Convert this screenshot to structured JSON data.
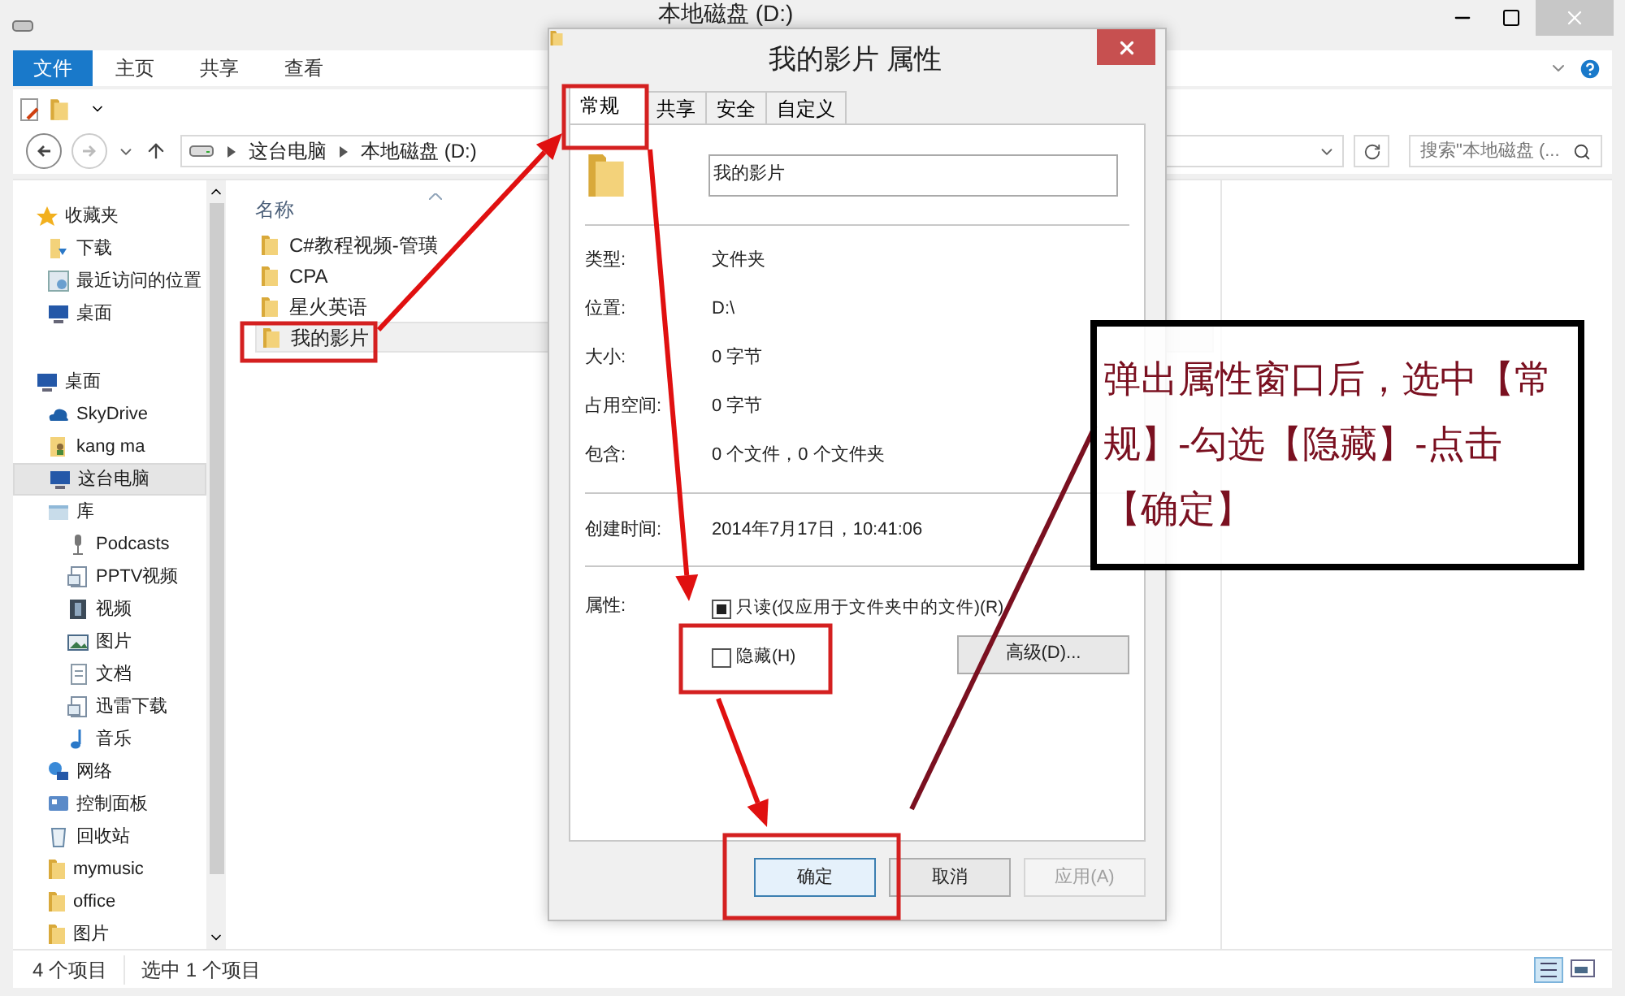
{
  "window": {
    "title": "本地磁盘 (D:)"
  },
  "ribbon_tabs": [
    {
      "label": "文件",
      "kind": "file-menu"
    },
    {
      "label": "主页",
      "kind": "tab"
    },
    {
      "label": "共享",
      "kind": "tab"
    },
    {
      "label": "查看",
      "kind": "tab"
    }
  ],
  "address": {
    "crumbs": [
      "这台电脑",
      "本地磁盘 (D:)"
    ]
  },
  "search": {
    "placeholder": "搜索\"本地磁盘 (..."
  },
  "sidebar": {
    "items": [
      {
        "label": "收藏夹",
        "kind": "star",
        "selected": false,
        "children": [
          {
            "label": "下载",
            "kind": "download",
            "selected": false
          },
          {
            "label": "最近访问的位置",
            "kind": "recent",
            "selected": false
          },
          {
            "label": "桌面",
            "kind": "desktop",
            "selected": false
          }
        ]
      },
      {
        "label": "桌面",
        "kind": "desktop",
        "selected": false,
        "children": [
          {
            "label": "SkyDrive",
            "kind": "cloud",
            "selected": false
          },
          {
            "label": "kang ma",
            "kind": "user",
            "selected": false
          },
          {
            "label": "这台电脑",
            "kind": "computer",
            "selected": true
          },
          {
            "label": "库",
            "kind": "library",
            "selected": false,
            "children": [
              {
                "label": "Podcasts",
                "kind": "podcast",
                "selected": false
              },
              {
                "label": "PPTV视频",
                "kind": "file",
                "selected": false
              },
              {
                "label": "视频",
                "kind": "video",
                "selected": false
              },
              {
                "label": "图片",
                "kind": "image",
                "selected": false
              },
              {
                "label": "文档",
                "kind": "document",
                "selected": false
              },
              {
                "label": "迅雷下载",
                "kind": "file",
                "selected": false
              },
              {
                "label": "音乐",
                "kind": "music",
                "selected": false
              }
            ]
          },
          {
            "label": "网络",
            "kind": "network",
            "selected": false
          },
          {
            "label": "控制面板",
            "kind": "panel",
            "selected": false
          },
          {
            "label": "回收站",
            "kind": "recycle",
            "selected": false
          },
          {
            "label": "mymusic",
            "kind": "folder",
            "selected": false
          },
          {
            "label": "office",
            "kind": "folder",
            "selected": false
          },
          {
            "label": "图片",
            "kind": "folder",
            "selected": false
          }
        ]
      }
    ]
  },
  "files": {
    "columns": [
      "名称"
    ],
    "rows": [
      {
        "name": "C#教程视频-管璜",
        "selected": false
      },
      {
        "name": "CPA",
        "selected": false
      },
      {
        "name": "星火英语",
        "selected": false
      },
      {
        "name": "我的影片",
        "selected": true
      }
    ]
  },
  "status_bar": [
    "4 个项目",
    "选中 1 个项目"
  ],
  "dialog": {
    "title": "我的影片 属性",
    "tabs": [
      {
        "label": "常规",
        "selected": true
      },
      {
        "label": "共享",
        "selected": false
      },
      {
        "label": "安全",
        "selected": false
      },
      {
        "label": "自定义",
        "selected": false
      }
    ],
    "name_field": {
      "value": "我的影片"
    },
    "details": [
      {
        "label": "类型:",
        "value": "文件夹"
      },
      {
        "label": "位置:",
        "value": "D:\\"
      },
      {
        "label": "大小:",
        "value": "0 字节"
      },
      {
        "label": "占用空间:",
        "value": "0 字节"
      },
      {
        "label": "包含:",
        "value": "0 个文件，0 个文件夹"
      }
    ],
    "created": {
      "label": "创建时间:",
      "value": "2014年7月17日，10:41:06"
    },
    "attributes_label": "属性:",
    "attributes": [
      {
        "label": "只读(仅应用于文件夹中的文件)(R)",
        "checked": false,
        "indeterminate": true
      },
      {
        "label": "隐藏(H)",
        "checked": false,
        "indeterminate": false
      }
    ],
    "advanced_button": "高级(D)...",
    "buttons": [
      {
        "label": "确定",
        "default": true,
        "disabled": false
      },
      {
        "label": "取消",
        "default": false,
        "disabled": false
      },
      {
        "label": "应用(A)",
        "default": false,
        "disabled": true
      }
    ]
  },
  "annotation": {
    "text": "弹出属性窗口后，选中【常规】-勾选【隐藏】-点击【确定】"
  }
}
